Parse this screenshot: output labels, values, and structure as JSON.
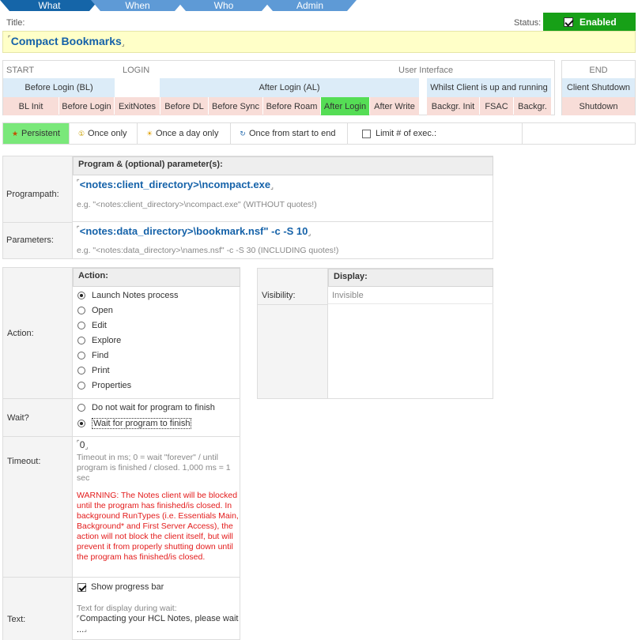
{
  "tabs": [
    {
      "label": "What"
    },
    {
      "label": "When"
    },
    {
      "label": "Who"
    },
    {
      "label": "Admin"
    }
  ],
  "title": {
    "label": "Title:",
    "value": "Compact Bookmarks"
  },
  "status": {
    "label": "Status:",
    "value": "Enabled"
  },
  "runtypes": {
    "groups": {
      "start": "START",
      "login": "LOGIN",
      "ui": "User Interface",
      "end": "END"
    },
    "phases": {
      "before_login": "Before Login (BL)",
      "after_login": "After Login (AL)",
      "whilst": "Whilst Client is up and running",
      "client_shutdown": "Client Shutdown"
    },
    "types": {
      "bl_init": "BL Init",
      "before_login": "Before Login",
      "exitnotes": "ExitNotes",
      "before_dl": "Before DL",
      "before_sync": "Before Sync",
      "before_roam": "Before Roam",
      "after_login": "After Login",
      "after_write": "After Write",
      "backgr_init": "Backgr. Init",
      "fsac": "FSAC",
      "backgr": "Backgr.",
      "shutdown": "Shutdown"
    }
  },
  "frequency": {
    "persistent": "Persistent",
    "once_only": "Once only",
    "once_a_day": "Once a day only",
    "once_start_end": "Once from start to end",
    "limit": "Limit # of exec.:"
  },
  "program": {
    "header": "Program & (optional) parameter(s):",
    "programpath_label": "Programpath:",
    "programpath_value": "<notes:client_directory>\\ncompact.exe",
    "programpath_hint": "e.g. \"<notes:client_directory>\\ncompact.exe\" (WITHOUT quotes!)",
    "parameters_label": "Parameters:",
    "parameters_value": "<notes:data_directory>\\bookmark.nsf\" -c -S 10",
    "parameters_hint": "e.g. \"<notes:data_directory>\\names.nsf\" -c -S 30 (INCLUDING quotes!)"
  },
  "action": {
    "header": "Action:",
    "label": "Action:",
    "options": [
      "Launch Notes process",
      "Open",
      "Edit",
      "Explore",
      "Find",
      "Print",
      "Properties"
    ],
    "selected": 0
  },
  "wait": {
    "label": "Wait?",
    "no_wait": "Do not wait for program to finish",
    "wait": "Wait for program to finish"
  },
  "timeout": {
    "label": "Timeout:",
    "value": "0",
    "hint": "Timeout in ms; 0 = wait \"forever\" / until program is finished / closed. 1,000 ms = 1 sec",
    "warning": "WARNING: The Notes client will be blocked until the program has finished/is closed. In background RunTypes (i.e. Essentials Main, Background* and First Server Access), the action will not block the client itself, but will prevent it from properly shutting down until the program has finished/is closed."
  },
  "text": {
    "label": "Text:",
    "show_progress": "Show progress bar",
    "hint": "Text for display during wait:",
    "value": "Compacting your HCL Notes, please wait ..."
  },
  "display": {
    "header": "Display:",
    "visibility_label": "Visibility:",
    "visibility_value": "Invisible"
  },
  "colors": {
    "accent": "#1565a8",
    "enabled": "#17a017",
    "selected": "#55dd55",
    "warning": "#e31b1b"
  }
}
